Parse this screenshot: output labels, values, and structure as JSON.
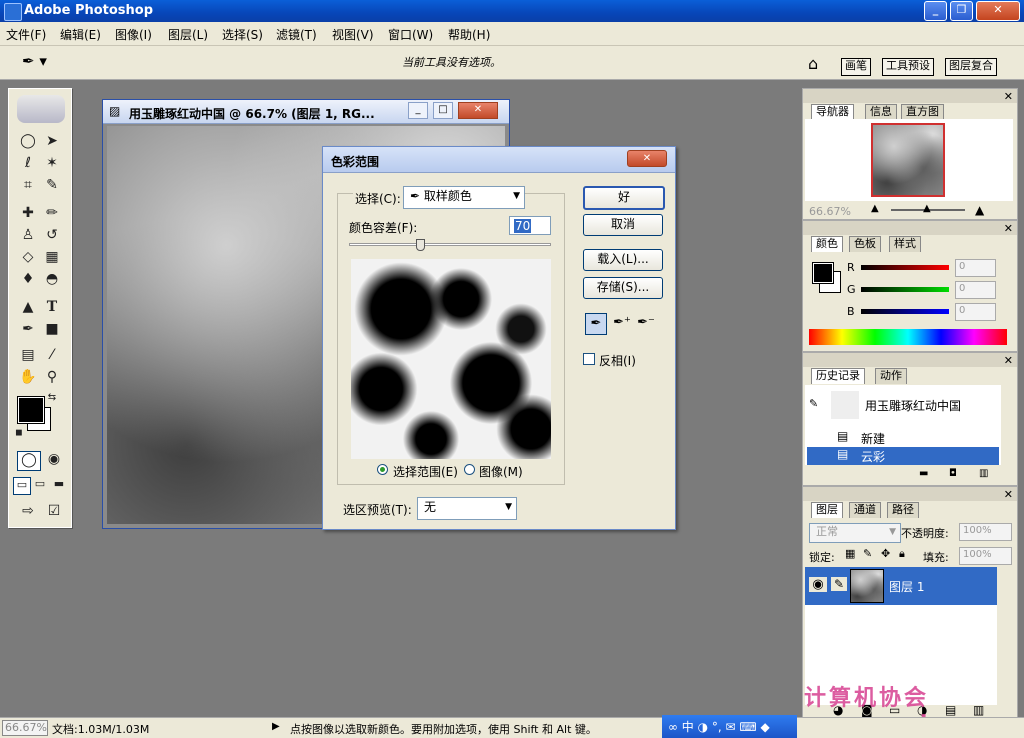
{
  "app": {
    "title": "Adobe Photoshop"
  },
  "menu": [
    "文件(F)",
    "编辑(E)",
    "图像(I)",
    "图层(L)",
    "选择(S)",
    "滤镜(T)",
    "视图(V)",
    "窗口(W)",
    "帮助(H)"
  ],
  "options_bar": {
    "hint": "当前工具没有选项。",
    "palette_tabs": [
      "画笔",
      "工具预设",
      "图层复合"
    ]
  },
  "document": {
    "title": "用玉雕琢红动中国 @ 66.7% (图层 1, RG..."
  },
  "dialog": {
    "title": "色彩范围",
    "select_label": "选择(C):",
    "select_value": "取样颜色",
    "fuzziness_label": "颜色容差(F):",
    "fuzziness_value": "70",
    "fuzziness_fraction": 0.35,
    "ok": "好",
    "cancel": "取消",
    "load": "载入(L)...",
    "save": "存储(S)...",
    "invert": "反相(I)",
    "radio_selection": "选择范围(E)",
    "radio_image": "图像(M)",
    "preview_label": "选区预览(T):",
    "preview_value": "无"
  },
  "navigator": {
    "tabs": [
      "导航器",
      "信息",
      "直方图"
    ],
    "zoom": "66.67%"
  },
  "color_palette": {
    "tabs": [
      "颜色",
      "色板",
      "样式"
    ],
    "channels": [
      {
        "label": "R",
        "value": "0"
      },
      {
        "label": "G",
        "value": "0"
      },
      {
        "label": "B",
        "value": "0"
      }
    ]
  },
  "history": {
    "tabs": [
      "历史记录",
      "动作"
    ],
    "snapshot": "用玉雕琢红动中国",
    "items": [
      "新建",
      "云彩"
    ]
  },
  "layers": {
    "tabs": [
      "图层",
      "通道",
      "路径"
    ],
    "blend_mode": "正常",
    "opacity_label": "不透明度:",
    "opacity_value": "100%",
    "lock_label": "锁定:",
    "fill_label": "填充:",
    "fill_value": "100%",
    "layer_name": "图层 1"
  },
  "status": {
    "zoom": "66.67%",
    "doc_size": "文档:1.03M/1.03M",
    "message": "点按图像以选取新颜色。要用附加选项，使用 Shift 和 Alt 键。"
  },
  "watermark": "计算机协会 www.gxjmca.com"
}
